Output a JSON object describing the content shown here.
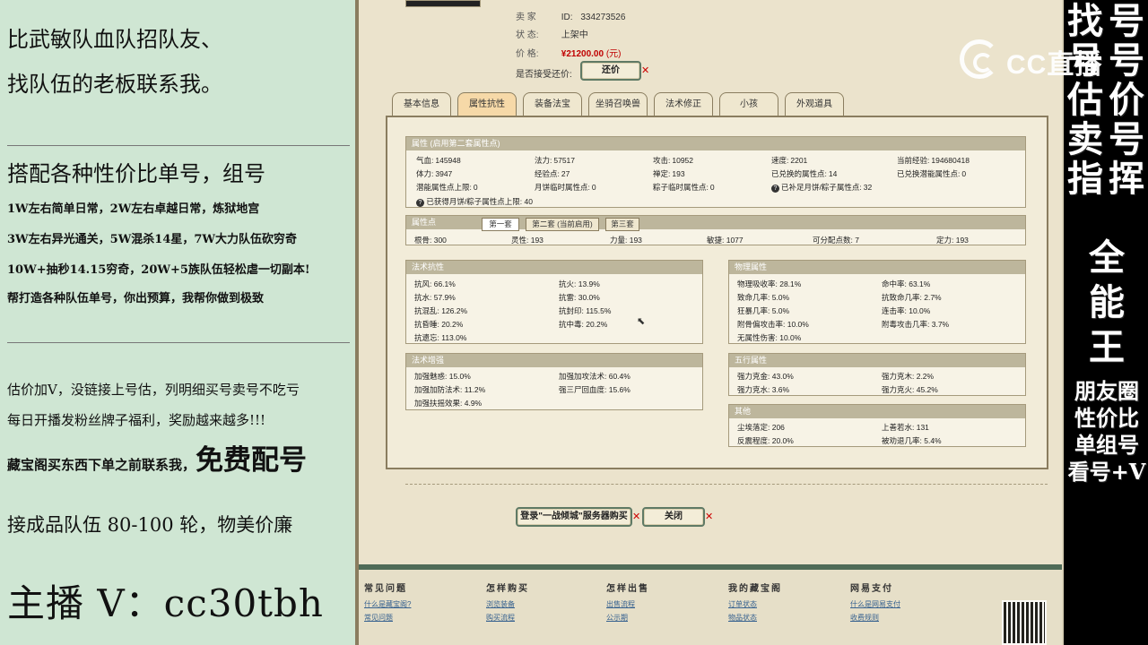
{
  "left": {
    "line1": "比武敏队血队招队友、",
    "line2": "找队伍的老板联系我。",
    "line3": "搭配各种性价比单号，组号",
    "line4": "1W左右简单日常，2W左右卓越日常，炼狱地宫",
    "line5": "3W左右异光通关，5W混杀14星，7W大力队伍砍穷奇",
    "line6": "10W+抽秒14.15穷奇，20W+5族队伍轻松虐一切副本!",
    "line7": "帮打造各种队伍单号，你出预算，我帮你做到极致",
    "line8": "估价加V，没链接上号估，列明细买号卖号不吃亏",
    "line9": "每日开播发粉丝牌子福利，奖励越来越多!!!",
    "line10a": "藏宝阁买东西下单之前联系我，",
    "line10b": "免费配号",
    "line11": "接成品队伍 80-100 轮，物美价廉",
    "line12": "主播 V：cc30tbh"
  },
  "seller": {
    "seller_key": "卖    家",
    "seller_id_label": "ID:",
    "seller_id": "334273526",
    "status_key": "状    态:",
    "status": "上架中",
    "price_key": "价    格:",
    "price": "¥21200.00",
    "price_unit": "(元)",
    "bargain_key": "是否接受还价:",
    "bargain_button": "还价"
  },
  "tabs": [
    "基本信息",
    "属性抗性",
    "装备法宝",
    "坐骑召唤兽",
    "法术修正",
    "小孩",
    "外观道具"
  ],
  "attr": {
    "header": "属性 (启用第二套属性点)",
    "rows": [
      [
        "气血:",
        "145948",
        "法力:",
        "57517",
        "攻击:",
        "10952",
        "速度:",
        "2201",
        "当前经验:",
        "194680418"
      ],
      [
        "体力:",
        "3947",
        "经验点:",
        "27",
        "禅定:",
        "193",
        "已兑换的属性点:",
        "14",
        "已兑换潜能属性点:",
        "0"
      ],
      [
        "潜能属性点上限:",
        "0",
        "月饼临时属性点:",
        "0",
        "粽子临时属性点:",
        "0",
        "已补足月饼/粽子属性点:",
        "32",
        "",
        ""
      ]
    ],
    "note": "已获得月饼/粽子属性点上限: 40"
  },
  "points": {
    "header": "属性点",
    "subtabs": [
      "第一套",
      "第二套 (当前启用)",
      "第三套"
    ],
    "row": [
      "根骨: 300",
      "灵性: 193",
      "力量: 193",
      "敏捷: 1077",
      "可分配点数: 7",
      "定力: 193"
    ]
  },
  "magic_resist": {
    "header": "法术抗性",
    "rows": [
      [
        "抗风: 66.1%",
        "抗火: 13.9%"
      ],
      [
        "抗水: 57.9%",
        "抗雷: 30.0%"
      ],
      [
        "抗混乱: 126.2%",
        "抗封印: 115.5%"
      ],
      [
        "抗昏睡: 20.2%",
        "抗中毒: 20.2%"
      ],
      [
        "抗遗忘: 113.0%",
        ""
      ]
    ]
  },
  "phys_attr": {
    "header": "物理属性",
    "rows": [
      [
        "物理吸收率: 28.1%",
        "命中率: 63.1%"
      ],
      [
        "致命几率: 5.0%",
        "抗致命几率: 2.7%"
      ],
      [
        "狂暴几率: 5.0%",
        "连击率: 10.0%"
      ],
      [
        "附骨偏攻击率: 10.0%",
        "附毒攻击几率: 3.7%"
      ],
      [
        "无属性伤害: 10.0%",
        ""
      ]
    ]
  },
  "magic_boost": {
    "header": "法术增强",
    "rows": [
      [
        "加强魅惑: 15.0%",
        "加强加攻法术: 60.4%"
      ],
      [
        "加强加防法术: 11.2%",
        "强三尸回血度: 15.6%"
      ],
      [
        "加强扶摇效果: 4.9%",
        ""
      ]
    ]
  },
  "five": {
    "header": "五行属性",
    "rows": [
      [
        "强力克金: 43.0%",
        "强力克木: 2.2%"
      ],
      [
        "强力克水: 3.6%",
        "强力克火: 45.2%"
      ]
    ]
  },
  "other": {
    "header": "其他",
    "rows": [
      [
        "尘埃落定: 206",
        "上善若水: 131"
      ],
      [
        "反震程度: 20.0%",
        "被劝退几率: 5.4%"
      ]
    ]
  },
  "buttons": {
    "login_buy": "登录\"一战倾城\"服务器购买",
    "close": "关闭"
  },
  "footer": [
    {
      "title": "常见问题",
      "links": [
        "什么是藏宝阁?",
        "常见问题"
      ]
    },
    {
      "title": "怎样购买",
      "links": [
        "浏览装备",
        "购买流程"
      ]
    },
    {
      "title": "怎样出售",
      "links": [
        "出售流程",
        "公示期"
      ]
    },
    {
      "title": "我的藏宝阁",
      "links": [
        "订单状态",
        "物品状态"
      ]
    },
    {
      "title": "网易支付",
      "links": [
        "什么是网易支付",
        "收费规则"
      ]
    }
  ],
  "right": {
    "col1": [
      "找",
      "号",
      "估",
      "卖",
      "指"
    ],
    "col2": [
      "号",
      "号",
      "价",
      "号",
      "挥"
    ],
    "mid": [
      "全",
      "能",
      "王"
    ],
    "bottom": [
      "朋友圈",
      "性价比",
      "单组号",
      "看号+V"
    ],
    "watermark": "CC直播"
  }
}
